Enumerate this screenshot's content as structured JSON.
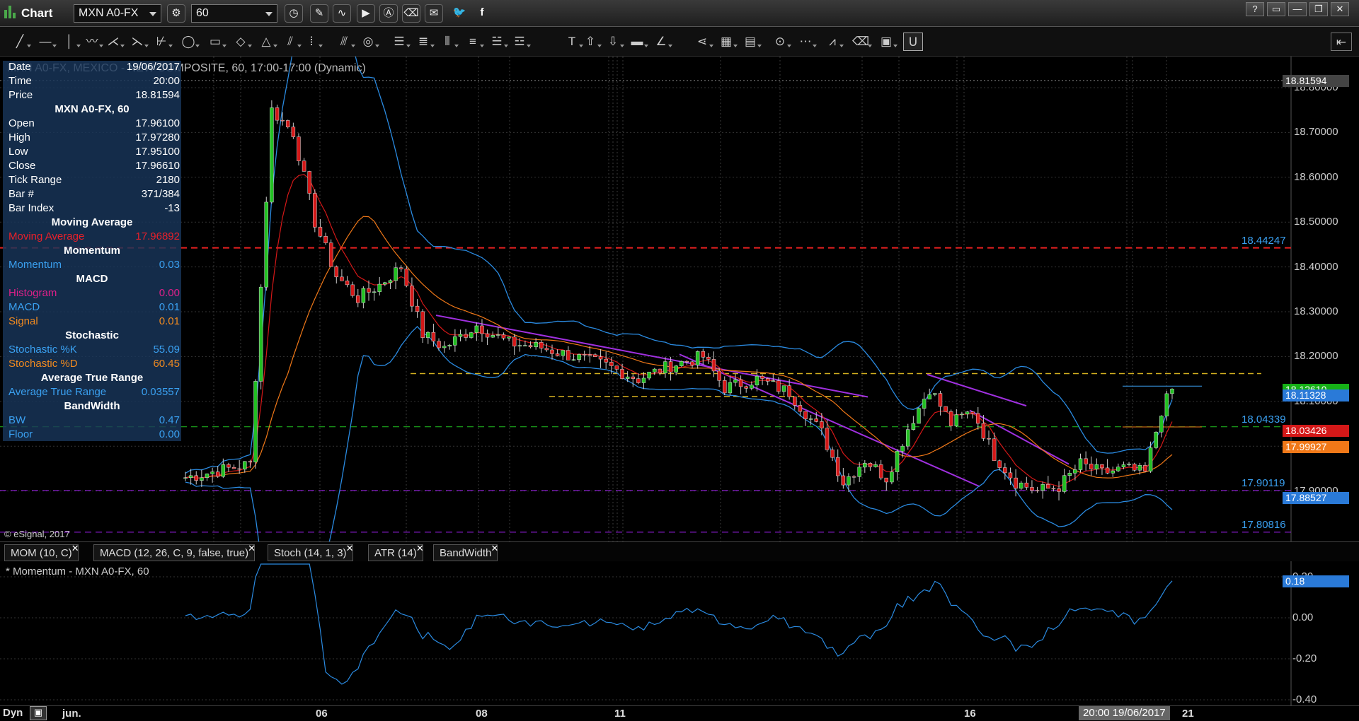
{
  "window": {
    "title": "Chart",
    "symbol": "MXN A0-FX",
    "interval": "60",
    "controls": [
      "?",
      "▭",
      "—",
      "❐",
      "✕"
    ]
  },
  "title_toolbar_icons": [
    "clock-icon",
    "pencil-icon",
    "chart-wave-icon",
    "play-icon",
    "alert-icon",
    "eraser-icon",
    "comment-icon",
    "twitter-icon",
    "facebook-icon"
  ],
  "drawing_toolbar": {
    "tools": [
      {
        "name": "trendline-tool",
        "glyph": "╱"
      },
      {
        "name": "horizontal-line-tool",
        "glyph": "—"
      },
      {
        "name": "vertical-line-tool",
        "glyph": "│"
      },
      {
        "name": "zigzag-tool",
        "glyph": "〰"
      },
      {
        "name": "pitchfork-tool",
        "glyph": "⋌"
      },
      {
        "name": "fan-tool",
        "glyph": "⋋"
      },
      {
        "name": "gann-fan-tool",
        "glyph": "⊬"
      },
      {
        "name": "ellipse-tool",
        "glyph": "◯"
      },
      {
        "name": "rectangle-tool",
        "glyph": "▭"
      },
      {
        "name": "polygon-tool",
        "glyph": "◇"
      },
      {
        "name": "triangle-tool",
        "glyph": "△"
      },
      {
        "name": "channel-tool",
        "glyph": "⫽"
      },
      {
        "name": "cycle-lines-tool",
        "glyph": "⦙"
      },
      {
        "name": "parallel-lines-tool",
        "glyph": "⫻"
      },
      {
        "name": "circles-tool",
        "glyph": "◎"
      },
      {
        "name": "fibonacci-tool",
        "glyph": "☰"
      },
      {
        "name": "fibonacci-extension-tool",
        "glyph": "≣"
      },
      {
        "name": "fibonacci-time-tool",
        "glyph": "⦀"
      },
      {
        "name": "retracement-tool",
        "glyph": "≡"
      },
      {
        "name": "speed-lines-tool",
        "glyph": "☱"
      },
      {
        "name": "regression-tool",
        "glyph": "☲"
      },
      {
        "name": "text-tool",
        "glyph": "T"
      },
      {
        "name": "arrow-up-tool",
        "glyph": "⇧"
      },
      {
        "name": "arrow-down-tool",
        "glyph": "⇩"
      },
      {
        "name": "marker-tool",
        "glyph": "▬"
      },
      {
        "name": "angle-tool",
        "glyph": "∠"
      },
      {
        "name": "andrews-tool",
        "glyph": "⋖"
      },
      {
        "name": "grid-tool",
        "glyph": "▦"
      },
      {
        "name": "market-profile-tool",
        "glyph": "▤"
      },
      {
        "name": "time-price-tool",
        "glyph": "⊙"
      },
      {
        "name": "pti-tool",
        "glyph": "⋯"
      },
      {
        "name": "wave-tool",
        "glyph": "⩘"
      },
      {
        "name": "clear-drawings-tool",
        "glyph": "⌫"
      },
      {
        "name": "annotation-tool",
        "glyph": "▣"
      },
      {
        "name": "magnet-tool",
        "glyph": "Ս"
      }
    ]
  },
  "chart_description": "MXN A0-FX, MEXICO - NEW COMPOSITE, 60, 17:00-17:00 (Dynamic)",
  "copyright": "© eSignal, 2017",
  "data_window": {
    "rows": [
      {
        "k": "Date",
        "v": "19/06/2017",
        "color": "#ffffff"
      },
      {
        "k": "Time",
        "v": "20:00",
        "color": "#ffffff"
      },
      {
        "k": "Price",
        "v": "18.81594",
        "color": "#ffffff"
      }
    ],
    "symbol_heading": "MXN A0-FX, 60",
    "ohlc": [
      {
        "k": "Open",
        "v": "17.96100"
      },
      {
        "k": "High",
        "v": "17.97280"
      },
      {
        "k": "Low",
        "v": "17.95100"
      },
      {
        "k": "Close",
        "v": "17.96610"
      },
      {
        "k": "Tick Range",
        "v": "2180"
      },
      {
        "k": "Bar #",
        "v": "371/384"
      },
      {
        "k": "Bar Index",
        "v": "-13"
      }
    ],
    "sections": [
      {
        "heading": "Moving Average",
        "rows": [
          {
            "k": "Moving Average",
            "v": "17.96892",
            "color": "#e8202a"
          }
        ]
      },
      {
        "heading": "Momentum",
        "rows": [
          {
            "k": "Momentum",
            "v": "0.03",
            "color": "#3aa0f0"
          }
        ]
      },
      {
        "heading": "MACD",
        "rows": [
          {
            "k": "Histogram",
            "v": "0.00",
            "color": "#e0208a"
          },
          {
            "k": "MACD",
            "v": "0.01",
            "color": "#3aa0f0"
          },
          {
            "k": "Signal",
            "v": "0.01",
            "color": "#f08a20"
          }
        ]
      },
      {
        "heading": "Stochastic",
        "rows": [
          {
            "k": "Stochastic %K",
            "v": "55.09",
            "color": "#3aa0f0"
          },
          {
            "k": "Stochastic %D",
            "v": "60.45",
            "color": "#f08a20"
          }
        ]
      },
      {
        "heading": "Average True Range",
        "rows": [
          {
            "k": "Average True Range",
            "v": "0.03557",
            "color": "#3aa0f0"
          }
        ]
      },
      {
        "heading": "BandWidth",
        "rows": [
          {
            "k": "BW",
            "v": "0.47",
            "color": "#3aa0f0"
          },
          {
            "k": "Floor",
            "v": "0.00",
            "color": "#3aa0f0"
          }
        ]
      }
    ]
  },
  "price_axis": {
    "ticks": [
      "18.80000",
      "18.70000",
      "18.60000",
      "18.50000",
      "18.40000",
      "18.30000",
      "18.20000",
      "18.10000",
      "18.00000",
      "17.90000"
    ],
    "cursor_price": "18.81594",
    "labels": [
      {
        "text": "18.12610",
        "bg": "#16b016",
        "fg": "#ffffff"
      },
      {
        "text": "18.11328",
        "bg": "#2a7ad8",
        "fg": "#ffffff"
      },
      {
        "text": "18.03426",
        "bg": "#d41818",
        "fg": "#ffffff"
      },
      {
        "text": "17.99927",
        "bg": "#f07818",
        "fg": "#ffffff"
      },
      {
        "text": "17.88527",
        "bg": "#2a7ad8",
        "fg": "#ffffff"
      }
    ],
    "line_labels": [
      {
        "text": "18.44247",
        "color": "#3aa0f0"
      },
      {
        "text": "18.04339",
        "color": "#3aa0f0"
      },
      {
        "text": "17.90119",
        "color": "#3aa0f0"
      },
      {
        "text": "17.80816",
        "color": "#3aa0f0"
      }
    ]
  },
  "indicator_tabs": [
    "MOM (10, C)",
    "MACD (12, 26, C, 9, false, true)",
    "Stoch (14, 1, 3)",
    "ATR (14)",
    "BandWidth"
  ],
  "lower_pane": {
    "title": "* Momentum - MXN A0-FX, 60",
    "ticks": [
      "0.20",
      "0.00",
      "-0.20",
      "-0.40"
    ],
    "current_value": "0.18"
  },
  "time_axis": {
    "dyn_label": "Dyn",
    "ticks": [
      "jun.",
      "06",
      "08",
      "11",
      "16",
      "21"
    ],
    "cursor_time": "20:00 19/06/2017"
  },
  "chart_data": {
    "type": "candlestick",
    "symbol": "MXN A0-FX",
    "interval": "60",
    "ylim": [
      17.808,
      18.83
    ],
    "x_ticks": [
      "jun.",
      "06",
      "08",
      "11",
      "16",
      "21"
    ],
    "close_path": [
      {
        "x": 0,
        "y": 17.93
      },
      {
        "x": 12,
        "y": 17.96
      },
      {
        "x": 16,
        "y": 18.75
      },
      {
        "x": 20,
        "y": 18.7
      },
      {
        "x": 24,
        "y": 18.5
      },
      {
        "x": 28,
        "y": 18.38
      },
      {
        "x": 32,
        "y": 18.33
      },
      {
        "x": 36,
        "y": 18.36
      },
      {
        "x": 40,
        "y": 18.4
      },
      {
        "x": 44,
        "y": 18.25
      },
      {
        "x": 48,
        "y": 18.22
      },
      {
        "x": 54,
        "y": 18.27
      },
      {
        "x": 60,
        "y": 18.23
      },
      {
        "x": 66,
        "y": 18.22
      },
      {
        "x": 72,
        "y": 18.2
      },
      {
        "x": 78,
        "y": 18.18
      },
      {
        "x": 84,
        "y": 18.15
      },
      {
        "x": 90,
        "y": 18.18
      },
      {
        "x": 96,
        "y": 18.2
      },
      {
        "x": 100,
        "y": 18.13
      },
      {
        "x": 106,
        "y": 18.15
      },
      {
        "x": 112,
        "y": 18.12
      },
      {
        "x": 118,
        "y": 18.03
      },
      {
        "x": 122,
        "y": 17.92
      },
      {
        "x": 126,
        "y": 17.97
      },
      {
        "x": 130,
        "y": 17.93
      },
      {
        "x": 134,
        "y": 18.04
      },
      {
        "x": 138,
        "y": 18.13
      },
      {
        "x": 142,
        "y": 18.05
      },
      {
        "x": 146,
        "y": 18.08
      },
      {
        "x": 150,
        "y": 17.98
      },
      {
        "x": 154,
        "y": 17.92
      },
      {
        "x": 158,
        "y": 17.9
      },
      {
        "x": 162,
        "y": 17.91
      },
      {
        "x": 166,
        "y": 17.96
      },
      {
        "x": 170,
        "y": 17.94
      },
      {
        "x": 174,
        "y": 17.95
      },
      {
        "x": 178,
        "y": 17.94
      },
      {
        "x": 181,
        "y": 18.08
      },
      {
        "x": 183,
        "y": 18.126
      }
    ],
    "horizontal_lines": [
      {
        "value": 18.44247,
        "color": "#e82020",
        "style": "dashed"
      },
      {
        "value": 18.04339,
        "color": "#20c020",
        "style": "dashed"
      },
      {
        "value": 17.90119,
        "color": "#a020f0",
        "style": "dashed"
      },
      {
        "value": 17.80816,
        "color": "#a020f0",
        "style": "dashed"
      }
    ],
    "momentum": {
      "ylim": [
        -0.4,
        0.2
      ],
      "current": 0.18
    }
  }
}
